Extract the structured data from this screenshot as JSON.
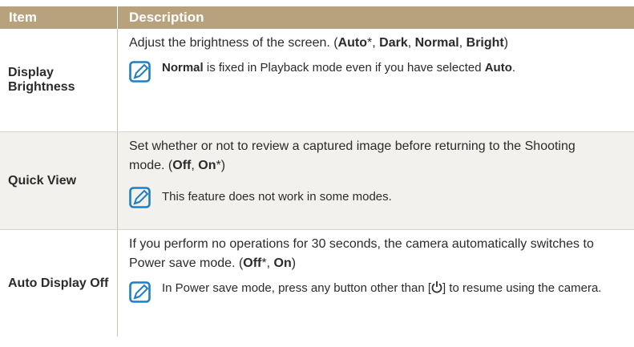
{
  "header": {
    "item": "Item",
    "description": "Description"
  },
  "rows": [
    {
      "item": "Display Brightness",
      "desc_pre": "Adjust the brightness of the screen. (",
      "opt1": "Auto",
      "opt1_suffix": "*, ",
      "opt2": "Dark",
      "sep2": ", ",
      "opt3": "Normal",
      "sep3": ", ",
      "opt4": "Bright",
      "desc_post": ")",
      "note_bold1": "Normal",
      "note_mid": " is fixed in Playback mode even if you have selected ",
      "note_bold2": "Auto",
      "note_end": ".",
      "note_icon": "note-pencil-icon"
    },
    {
      "item": "Quick View",
      "desc_pre": "Set whether or not to review a captured image before returning to the Shooting mode. (",
      "opt1": "Off",
      "sep1": ", ",
      "opt2": "On",
      "desc_post": "*)",
      "note": "This feature does not work in some modes.",
      "note_icon": "note-pencil-icon"
    },
    {
      "item": "Auto Display Off",
      "desc_pre": "If you perform no operations for 30 seconds, the camera automatically switches to Power save mode. (",
      "opt1": "Off",
      "sep1": "*, ",
      "opt2": "On",
      "desc_post": ")",
      "note_pre": "In Power save mode, press any button other than [",
      "note_post": "] to resume using the camera.",
      "power_icon": "power-icon",
      "note_icon": "note-pencil-icon"
    }
  ],
  "colors": {
    "header_bg": "#b8a27d",
    "icon_blue": "#1f7fc4",
    "shaded_row": "#f3f1ee"
  }
}
